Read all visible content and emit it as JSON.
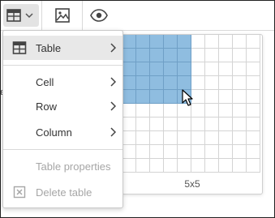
{
  "toolbar": {
    "buttons": [
      {
        "name": "table-insert",
        "icon": "table-icon",
        "has_dropdown": true,
        "active": true
      },
      {
        "name": "image-insert",
        "icon": "image-icon"
      },
      {
        "name": "preview",
        "icon": "eye-icon"
      }
    ]
  },
  "grid_picker": {
    "columns": 10,
    "rows": 10,
    "selected_columns": 5,
    "selected_rows": 5,
    "size_label": "5x5"
  },
  "menu": {
    "items": [
      {
        "label": "Table",
        "icon": "table-icon",
        "submenu": true,
        "highlighted": true
      },
      {
        "label": "Cell",
        "submenu": true
      },
      {
        "label": "Row",
        "submenu": true
      },
      {
        "label": "Column",
        "submenu": true
      },
      {
        "label": "Table properties",
        "disabled": true
      },
      {
        "label": "Delete table",
        "icon": "delete-box-icon",
        "disabled": true
      }
    ]
  },
  "colors": {
    "selected_cell": "#8fbde0",
    "icon": "#444444",
    "disabled": "#a6a6a6"
  }
}
